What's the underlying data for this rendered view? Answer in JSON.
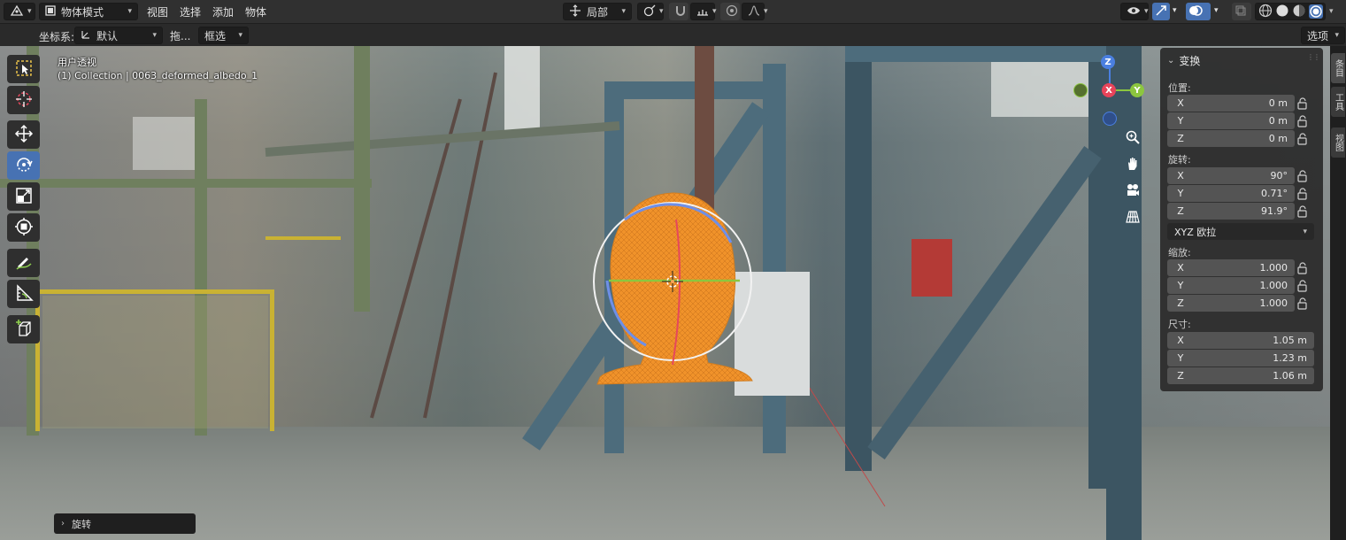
{
  "header": {
    "mode_label": "物体模式",
    "menus": [
      "视图",
      "选择",
      "添加",
      "物体"
    ],
    "pivot_label": "局部"
  },
  "toolbar2": {
    "coord_label": "坐标系:",
    "coord_value": "默认",
    "drag_label": "拖...",
    "select_mode": "框选",
    "options_label": "选项"
  },
  "viewport": {
    "view_name": "用户透视",
    "collection_info": "(1) Collection | 0063_deformed_albedo_1",
    "gizmo_axes": {
      "z": "Z",
      "x": "X",
      "y": "Y"
    }
  },
  "npanel": {
    "section_title": "变换",
    "location": {
      "label": "位置:",
      "x": "0 m",
      "y": "0 m",
      "z": "0 m"
    },
    "rotation": {
      "label": "旋转:",
      "x": "90°",
      "y": "0.71°",
      "z": "91.9°"
    },
    "rotation_mode": "XYZ 欧拉",
    "scale": {
      "label": "缩放:",
      "x": "1.000",
      "y": "1.000",
      "z": "1.000"
    },
    "dimensions": {
      "label": "尺寸:",
      "x": "1.05 m",
      "y": "1.23 m",
      "z": "1.06 m"
    },
    "axis_x": "X",
    "axis_y": "Y",
    "axis_z": "Z"
  },
  "side_tabs": [
    "条目",
    "工具",
    "视图"
  ],
  "operator_panel": {
    "title": "旋转"
  },
  "colors": {
    "accent": "#4772b3",
    "mesh_orange": "#f0922a",
    "axis_x": "#e8445a",
    "axis_y": "#8cc63f",
    "axis_z": "#4a7fe0"
  },
  "icons": {
    "editor_type": "editor-type-icon",
    "mode": "object-mode-icon",
    "select_tool": "select-box-icon",
    "cursor_tool": "cursor-icon",
    "move_tool": "move-icon",
    "rotate_tool": "rotate-icon",
    "scale_tool": "scale-icon",
    "transform_tool": "transform-icon",
    "annotate_tool": "annotate-icon",
    "measure_tool": "measure-icon",
    "add_cube_tool": "add-cube-icon"
  }
}
